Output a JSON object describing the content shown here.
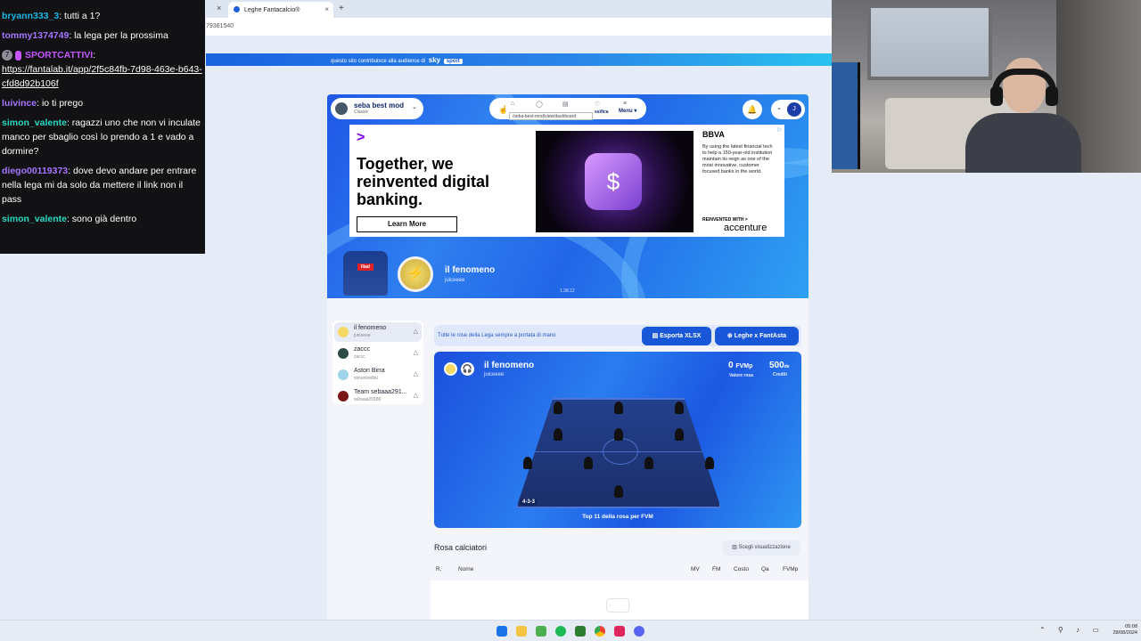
{
  "browser": {
    "tab_label": "Leghe Fantacalcio®",
    "tab_close": "×",
    "prev_tab_close": "×",
    "new_tab": "+",
    "url_fragment": "79361540"
  },
  "sky_banner": {
    "text": "questo sito contribuisce alla audience di",
    "brand": "sky",
    "brand2": "sport"
  },
  "chat": [
    {
      "user": "bryann333_3",
      "color": "#19b5e5",
      "text": ": tutti a 1?"
    },
    {
      "user": "tommy1374749",
      "color": "#a674ff",
      "text": ": la lega per la prossima"
    },
    {
      "user": "SPORTCATTIVI",
      "color": "#c657ff",
      "badge": "7",
      "text": ":",
      "link": "https://fantalab.it/app/2f5c84fb-7d98-463e-b643-cfd8d92b106f"
    },
    {
      "user": "luivince",
      "color": "#a674ff",
      "text": ": io ti prego"
    },
    {
      "user": "simon_valente",
      "color": "#29d9c2",
      "text": ": ragazzi uno che non vi inculate manco per sbaglio così lo prendo a 1 e vado a dormire?"
    },
    {
      "user": "diego00119373",
      "color": "#a674ff",
      "text": ": dove devo andare per entrare nella lega mi da solo da mettere il link non il pass"
    },
    {
      "user": "simon_valente",
      "color": "#29d9c2",
      "text": ": sono già dentro"
    }
  ],
  "app": {
    "league": {
      "name": "seba best mod",
      "type": "Classic"
    },
    "nav": {
      "classifica": "ssifica",
      "menu": "Menu ▾"
    },
    "tooltip": "/seba-best-mod/view/dashboard",
    "bell": "🔔",
    "user_initial": "J",
    "ad": {
      "headline": "Together, we reinvented digital banking.",
      "cta": "Learn More",
      "bbva": "BBVA",
      "body": "By using the latest financial tech to help a 150-year-old institution maintain its reign as one of the most innovative, customer focused banks in the world.",
      "reinvented": "REINVENTED WITH >",
      "accenture": "accenture",
      "adchoice": "▷"
    },
    "team_header": {
      "name": "il fenomeno",
      "owner": "juiceeee",
      "version": "1.38.12",
      "sponsor": "lliad"
    },
    "teams": [
      {
        "name": "il fenomeno",
        "owner": "juiceeee",
        "color": "#f3d863",
        "active": true
      },
      {
        "name": "zaccc",
        "owner": "zaccc",
        "color": "#2f4b45",
        "active": false
      },
      {
        "name": "Aston Birra",
        "owner": "simontonlbu",
        "color": "#9fd4ea",
        "active": false
      },
      {
        "name": "Team sebaaa291...",
        "owner": "sebaaa29186",
        "color": "#7b1515",
        "active": false
      }
    ],
    "info_text": "Tutte le rose della Lega sempre a portata di mano",
    "btn_xlsx": "▤  Esporta XLSX",
    "btn_asta": "⊕  Leghe x FantAsta",
    "pitch_card": {
      "name": "il fenomeno",
      "owner": "juiceeee",
      "fvm_value": "0",
      "fvm_unit": "FVMp",
      "fvm_label": "Valore rosa",
      "credits_value": "500",
      "credits_unit": "de",
      "credits_label": "Crediti",
      "formation": "4-3-3",
      "footer": "Top 11 della rosa per FVM"
    },
    "roster": {
      "title": "Rosa calciatori",
      "view_button": "▥  Scegli visualizzazione",
      "columns": [
        "R.",
        "Nome",
        "MV",
        "FM",
        "Costo",
        "Qa",
        "FVMp"
      ]
    }
  },
  "taskbar": {
    "tray": "⌃ ⚲ ♪ ▭",
    "time": "05:08",
    "date": "28/08/2024"
  }
}
